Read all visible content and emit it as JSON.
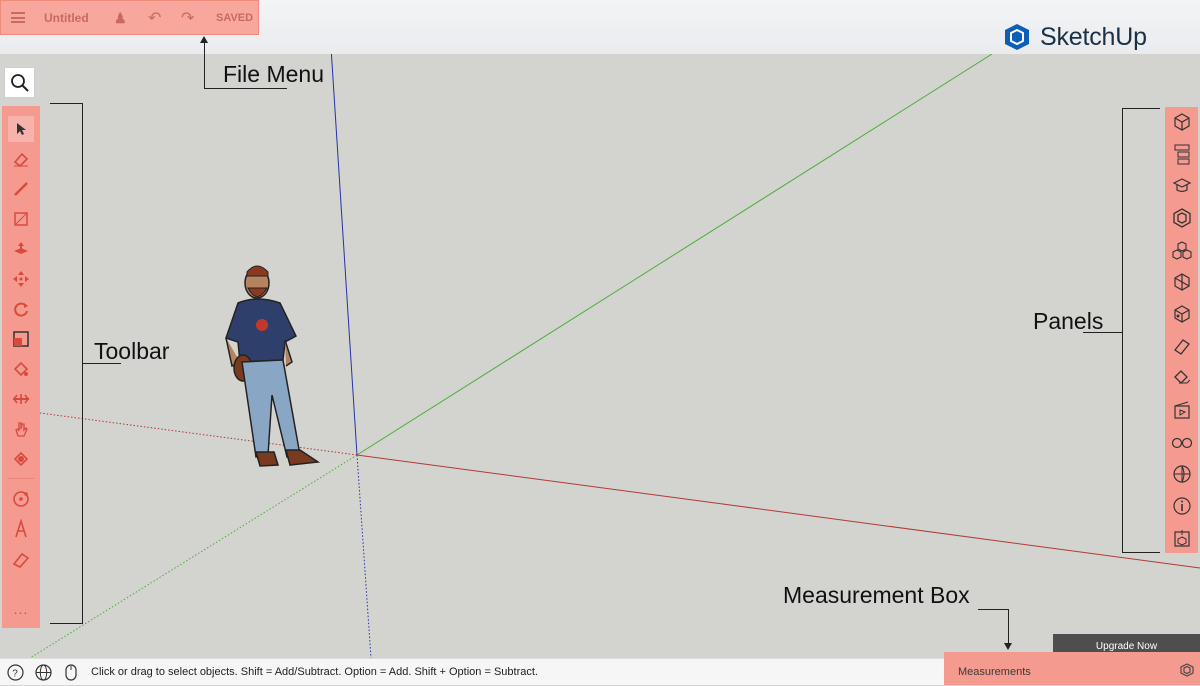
{
  "file_menu": {
    "title": "Untitled",
    "status": "SAVED"
  },
  "brand": {
    "name": "SketchUp"
  },
  "annotations": {
    "file_menu": "File Menu",
    "toolbar": "Toolbar",
    "panels": "Panels",
    "measurement_box": "Measurement Box"
  },
  "toolbar": {
    "tools": [
      "select",
      "eraser",
      "pencil",
      "rectangle",
      "push-pull",
      "move",
      "rotate",
      "scale",
      "paint",
      "offset",
      "orbit",
      "position",
      "tape-measure",
      "text",
      "section",
      "more"
    ],
    "more_label": "..."
  },
  "panels": {
    "items": [
      "entity-info",
      "outliner",
      "instructor",
      "components",
      "materials",
      "styles",
      "scenes",
      "tags",
      "soften",
      "scenes-video",
      "display",
      "shadows",
      "info",
      "model-info"
    ]
  },
  "upgrade": {
    "label": "Upgrade Now"
  },
  "status_bar": {
    "hint": "Click or drag to select objects. Shift = Add/Subtract. Option = Add. Shift + Option = Subtract."
  },
  "measurements": {
    "label": "Measurements"
  },
  "colors": {
    "highlight": "#f59a8f",
    "axis_red": "#b23a34",
    "axis_green": "#4caf3a",
    "axis_blue": "#2633a8"
  }
}
